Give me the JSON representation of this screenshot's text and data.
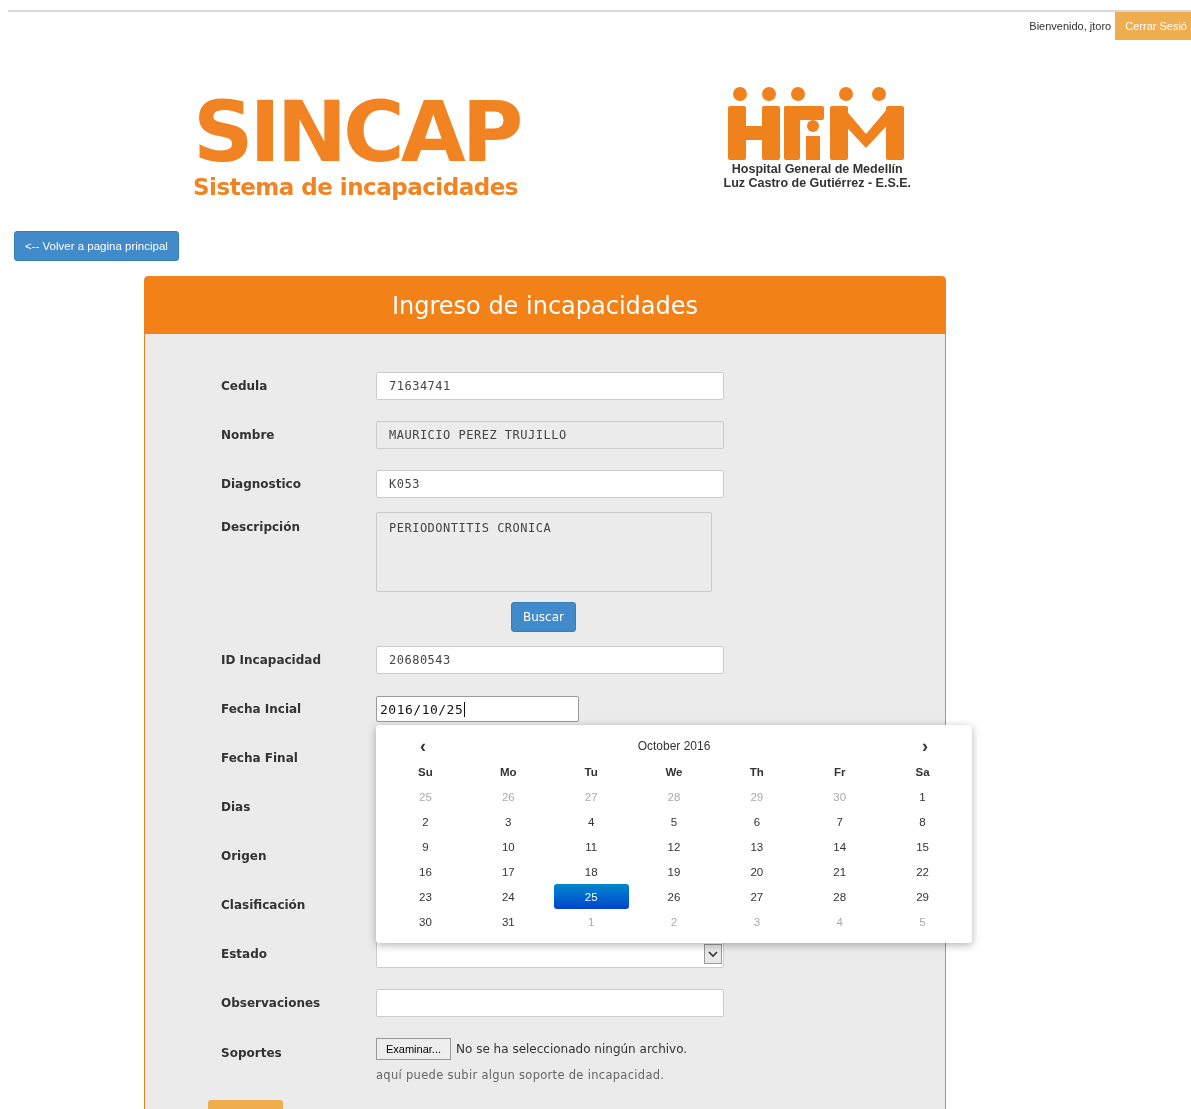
{
  "top_bar": {
    "welcome": "Bienvenido, jtoro",
    "logout": "Cerrar Sesió"
  },
  "logo": {
    "title": "SINCAP",
    "subtitle": "Sistema de incapacidades"
  },
  "hospital": {
    "line_1": "Hospital General de Medellín",
    "line_2": "Luz Castro de Gutiérrez - E.S.E."
  },
  "back_button": "<-- Volver a pagina principal",
  "form": {
    "title": "Ingreso de incapacidades",
    "fields": [
      {
        "kind": "input",
        "label": "Cedula",
        "value": "71634741",
        "disabled": false
      },
      {
        "kind": "input",
        "label": "Nombre",
        "value": "MAURICIO PEREZ TRUJILLO",
        "disabled": true
      },
      {
        "kind": "input",
        "label": "Diagnostico",
        "value": "K053",
        "disabled": false
      },
      {
        "kind": "textarea",
        "label": "Descripción",
        "value": "PERIODONTITIS CRONICA",
        "disabled": true
      },
      {
        "kind": "button",
        "label": "Buscar"
      },
      {
        "kind": "input",
        "label": "ID Incapacidad",
        "value": "20680543",
        "disabled": false
      },
      {
        "kind": "date",
        "label": "Fecha Incial",
        "value": "2016/10/25",
        "disabled": false
      },
      {
        "kind": "hidden",
        "label": "Fecha Final"
      },
      {
        "kind": "hidden",
        "label": "Dias"
      },
      {
        "kind": "hidden",
        "label": "Origen"
      },
      {
        "kind": "hidden",
        "label": "Clasificación"
      },
      {
        "kind": "select",
        "label": "Estado",
        "disabled": false
      },
      {
        "kind": "input",
        "label": "Observaciones",
        "disabled": false
      },
      {
        "kind": "file",
        "label": "Soportes",
        "button": "Examinar...",
        "status": "No se ha seleccionado ningún archivo.",
        "hint": "aquí puede subir algun soporte de incapacidad."
      }
    ]
  },
  "calendar": {
    "prev": "‹",
    "next": "›",
    "title": "October 2016",
    "weekdays": [
      "Su",
      "Mo",
      "Tu",
      "We",
      "Th",
      "Fr",
      "Sa"
    ],
    "weeks": [
      [
        {
          "day": "25",
          "other_month": true,
          "selected": false
        },
        {
          "day": "26",
          "other_month": true,
          "selected": false
        },
        {
          "day": "27",
          "other_month": true,
          "selected": false
        },
        {
          "day": "28",
          "other_month": true,
          "selected": false
        },
        {
          "day": "29",
          "other_month": true,
          "selected": false
        },
        {
          "day": "30",
          "other_month": true,
          "selected": false
        },
        {
          "day": "1",
          "other_month": false,
          "selected": false
        }
      ],
      [
        {
          "day": "2",
          "other_month": false,
          "selected": false
        },
        {
          "day": "3",
          "other_month": false,
          "selected": false
        },
        {
          "day": "4",
          "other_month": false,
          "selected": false
        },
        {
          "day": "5",
          "other_month": false,
          "selected": false
        },
        {
          "day": "6",
          "other_month": false,
          "selected": false
        },
        {
          "day": "7",
          "other_month": false,
          "selected": false
        },
        {
          "day": "8",
          "other_month": false,
          "selected": false
        }
      ],
      [
        {
          "day": "9",
          "other_month": false,
          "selected": false
        },
        {
          "day": "10",
          "other_month": false,
          "selected": false
        },
        {
          "day": "11",
          "other_month": false,
          "selected": false
        },
        {
          "day": "12",
          "other_month": false,
          "selected": false
        },
        {
          "day": "13",
          "other_month": false,
          "selected": false
        },
        {
          "day": "14",
          "other_month": false,
          "selected": false
        },
        {
          "day": "15",
          "other_month": false,
          "selected": false
        }
      ],
      [
        {
          "day": "16",
          "other_month": false,
          "selected": false
        },
        {
          "day": "17",
          "other_month": false,
          "selected": false
        },
        {
          "day": "18",
          "other_month": false,
          "selected": false
        },
        {
          "day": "19",
          "other_month": false,
          "selected": false
        },
        {
          "day": "20",
          "other_month": false,
          "selected": false
        },
        {
          "day": "21",
          "other_month": false,
          "selected": false
        },
        {
          "day": "22",
          "other_month": false,
          "selected": false
        }
      ],
      [
        {
          "day": "23",
          "other_month": false,
          "selected": false
        },
        {
          "day": "24",
          "other_month": false,
          "selected": false
        },
        {
          "day": "25",
          "other_month": false,
          "selected": true
        },
        {
          "day": "26",
          "other_month": false,
          "selected": false
        },
        {
          "day": "27",
          "other_month": false,
          "selected": false
        },
        {
          "day": "28",
          "other_month": false,
          "selected": false
        },
        {
          "day": "29",
          "other_month": false,
          "selected": false
        }
      ],
      [
        {
          "day": "30",
          "other_month": false,
          "selected": false
        },
        {
          "day": "31",
          "other_month": false,
          "selected": false
        },
        {
          "day": "1",
          "other_month": true,
          "selected": false
        },
        {
          "day": "2",
          "other_month": true,
          "selected": false
        },
        {
          "day": "3",
          "other_month": true,
          "selected": false
        },
        {
          "day": "4",
          "other_month": true,
          "selected": false
        },
        {
          "day": "5",
          "other_month": true,
          "selected": false
        }
      ]
    ]
  }
}
